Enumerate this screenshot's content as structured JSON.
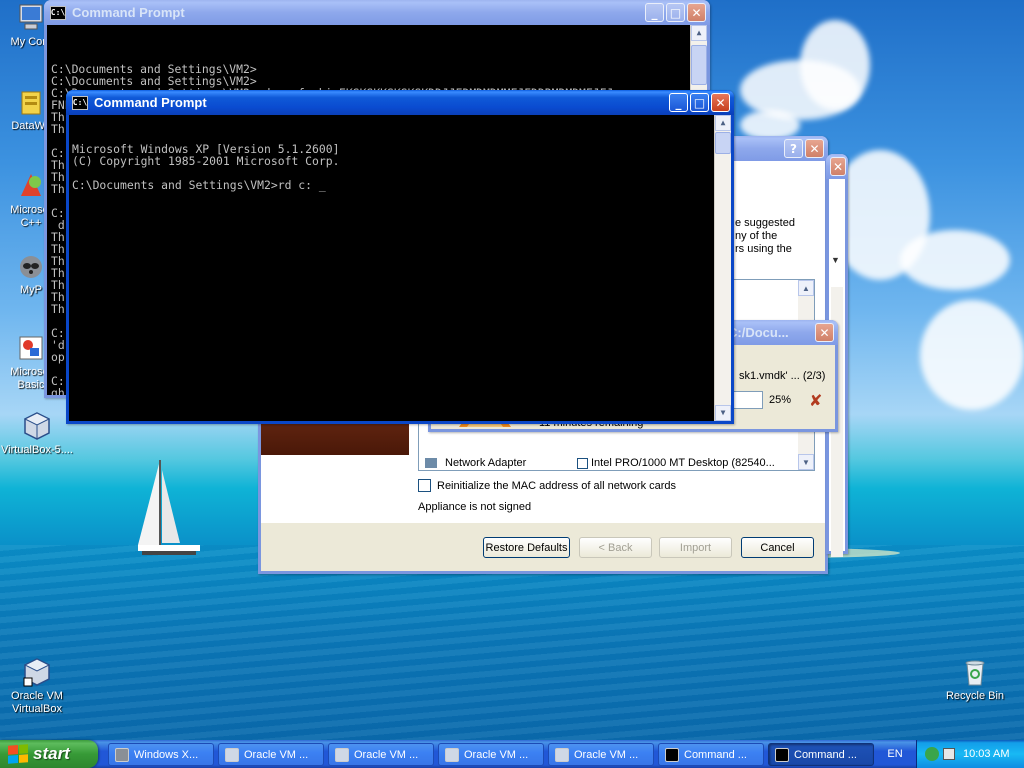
{
  "desktop": {
    "icons": [
      {
        "label": "My Com",
        "glyph": "computer-icon"
      },
      {
        "label": "DataWa",
        "glyph": "datawarehouse-icon"
      },
      {
        "label": "Microsof\nC++",
        "glyph": "visual-cpp-icon"
      },
      {
        "label": "MyP",
        "glyph": "raccoon-icon"
      },
      {
        "label": "Microsof\nBasic",
        "glyph": "visual-basic-icon"
      },
      {
        "label": "VirtualBox-5....",
        "glyph": "virtualbox-icon"
      },
      {
        "label": "Oracle VM\nVirtualBox",
        "glyph": "virtualbox-shortcut-icon"
      },
      {
        "label": "Recycle Bin",
        "glyph": "recycle-bin-icon"
      }
    ]
  },
  "back_console": {
    "title": "Command Prompt",
    "lines": [
      "C:\\Documents and Settings\\VM2>",
      "C:\\Documents and Settings\\VM2>",
      "C:\\Documents and Settings\\VM2>rd c: forkieEKSKSKKSKSKSKDDJJEDMDMDMMFJFDDRMDMDMFJFJ",
      "FNEFMDMJFJT",
      "Th",
      "Th",
      "",
      "C:",
      "Th",
      "Th",
      "Th",
      "",
      "C:",
      " d",
      "Th",
      "Th",
      "Th",
      "Th",
      "Th",
      "Th",
      "Th",
      "",
      "C:",
      "'d",
      "op",
      "",
      "C:",
      "gh"
    ]
  },
  "front_console": {
    "title": "Command Prompt",
    "lines": [
      "Microsoft Windows XP [Version 5.1.2600]",
      "(C) Copyright 1985-2001 Microsoft Corp.",
      "",
      "C:\\Documents and Settings\\VM2>rd c: _"
    ]
  },
  "wizard": {
    "partial_text": [
      "e suggested",
      "ny of the",
      "rs using the"
    ],
    "network_adapter_label": "Network Adapter",
    "network_adapter_value": "Intel PRO/1000 MT Desktop (82540...",
    "reinit_mac_label": "Reinitialize the MAC address of all network cards",
    "signed_status": "Appliance is not signed",
    "buttons": {
      "restore": "Restore Defaults",
      "back": "< Back",
      "import": "Import",
      "cancel": "Cancel"
    }
  },
  "progress_dialog": {
    "title_fragment": "C:/Docu...",
    "file_text": "sk1.vmdk' ... (2/3)",
    "percent_label": "25%",
    "percent": 25,
    "remaining": "11 minutes remaining"
  },
  "taskbar": {
    "start_label": "start",
    "items": [
      {
        "label": "Windows X...",
        "icon": "raccoon-icon"
      },
      {
        "label": "Oracle VM ...",
        "icon": "virtualbox-icon"
      },
      {
        "label": "Oracle VM ...",
        "icon": "virtualbox-icon"
      },
      {
        "label": "Oracle VM ...",
        "icon": "virtualbox-icon"
      },
      {
        "label": "Oracle VM ...",
        "icon": "virtualbox-icon"
      },
      {
        "label": "Command ...",
        "icon": "cmd-icon"
      },
      {
        "label": "Command ...",
        "icon": "cmd-icon"
      }
    ],
    "language": "EN",
    "clock": "10:03 AM"
  },
  "colors": {
    "title_active": "#0a4bd0",
    "title_inactive": "#8ea8ec",
    "taskbar": "#2157d7",
    "start": "#379a37"
  }
}
